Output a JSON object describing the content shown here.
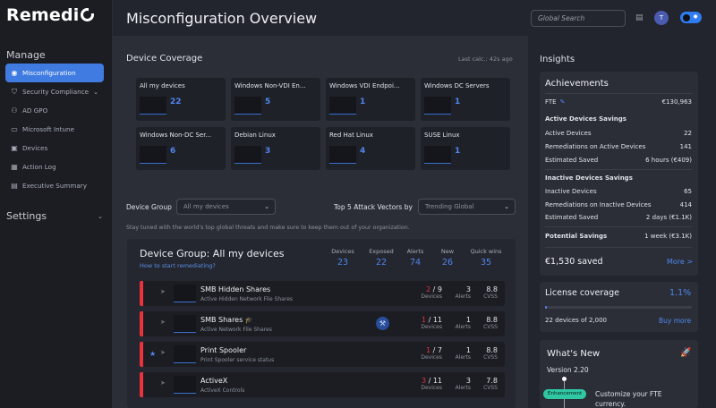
{
  "app": {
    "logo": "Remedi",
    "page_title": "Misconfiguration Overview"
  },
  "header": {
    "search_placeholder": "Global Search",
    "avatar_initial": "T"
  },
  "sidebar": {
    "manage_label": "Manage",
    "settings_label": "Settings",
    "items": [
      {
        "label": "Misconfiguration",
        "icon": "eye-icon",
        "active": true
      },
      {
        "label": "Security Compliance",
        "icon": "shield-icon",
        "has_chevron": true
      },
      {
        "label": "AD GPO",
        "icon": "users-icon"
      },
      {
        "label": "Microsoft Intune",
        "icon": "laptop-icon"
      },
      {
        "label": "Devices",
        "icon": "devices-icon"
      },
      {
        "label": "Action Log",
        "icon": "calendar-icon"
      },
      {
        "label": "Executive Summary",
        "icon": "report-icon"
      }
    ]
  },
  "coverage": {
    "title": "Device Coverage",
    "last_calc": "Last calc.: 42s ago",
    "cards": [
      {
        "name": "All my devices",
        "count": "22"
      },
      {
        "name": "Windows Non-VDI En...",
        "count": "5"
      },
      {
        "name": "Windows VDI Endpoi...",
        "count": "1"
      },
      {
        "name": "Windows DC Servers",
        "count": "1"
      },
      {
        "name": "Windows Non-DC Ser...",
        "count": "6"
      },
      {
        "name": "Debian Linux",
        "count": "3"
      },
      {
        "name": "Red Hat Linux",
        "count": "4"
      },
      {
        "name": "SUSE Linux",
        "count": "1"
      }
    ]
  },
  "filters": {
    "device_group_label": "Device Group",
    "device_group_value": "All my devices",
    "vectors_label": "Top 5 Attack Vectors by",
    "vectors_value": "Trending Global",
    "hint": "Stay tuned with the world's top global threats and make sure to keep them out of your organization."
  },
  "device_group": {
    "title": "Device Group: All my devices",
    "link": "How to start remediating?",
    "stats": [
      {
        "label": "Devices",
        "value": "23"
      },
      {
        "label": "Exposed",
        "value": "22"
      },
      {
        "label": "Alerts",
        "value": "74"
      },
      {
        "label": "New",
        "value": "26"
      },
      {
        "label": "Quick wins",
        "value": "35"
      }
    ],
    "vectors": [
      {
        "name": "SMB Hidden Shares",
        "desc": "Active Hidden Network File Shares",
        "devices_num": "2",
        "devices_den": "9",
        "alerts": "3",
        "cvss": "8.8",
        "starred": false,
        "tag": false,
        "extra_icon": false
      },
      {
        "name": "SMB Shares",
        "desc": "Active Network File Shares",
        "devices_num": "1",
        "devices_den": "11",
        "alerts": "1",
        "cvss": "8.8",
        "starred": false,
        "tag": true,
        "extra_icon": true
      },
      {
        "name": "Print Spooler",
        "desc": "Print Spooler service status",
        "devices_num": "1",
        "devices_den": "7",
        "alerts": "1",
        "cvss": "8.8",
        "starred": true,
        "tag": false,
        "extra_icon": false
      },
      {
        "name": "ActiveX",
        "desc": "ActiveX Controls",
        "devices_num": "3",
        "devices_den": "11",
        "alerts": "3",
        "cvss": "7.8",
        "starred": false,
        "tag": false,
        "extra_icon": false
      }
    ],
    "col_devices": "Devices",
    "col_alerts": "Alerts",
    "col_cvss": "CVSS"
  },
  "insights": {
    "title": "Insights",
    "achievements": {
      "title": "Achievements",
      "fte_label": "FTE",
      "fte_value": "€130,963",
      "active_heading": "Active Devices Savings",
      "active_devices_label": "Active Devices",
      "active_devices_value": "22",
      "active_rem_label": "Remediations on Active Devices",
      "active_rem_value": "141",
      "active_saved_label": "Estimated Saved",
      "active_saved_value": "6 hours (€409)",
      "inactive_heading": "Inactive Devices Savings",
      "inactive_devices_label": "Inactive Devices",
      "inactive_devices_value": "65",
      "inactive_rem_label": "Remediations on Inactive Devices",
      "inactive_rem_value": "414",
      "inactive_saved_label": "Estimated Saved",
      "inactive_saved_value": "2 days (€1.1K)",
      "potential_label": "Potential Savings",
      "potential_value": "1 week (€3.1K)",
      "saved_total": "€1,530 saved",
      "more_link": "More >"
    },
    "license": {
      "title": "License coverage",
      "percent": "1.1%",
      "fraction": 0.011,
      "subtitle": "22 devices of 2,000",
      "buy_link": "Buy more"
    },
    "whats_new": {
      "title": "What's New",
      "version": "Version 2.20",
      "pill": "Enhancement",
      "text": "Customize your FTE currency."
    }
  }
}
